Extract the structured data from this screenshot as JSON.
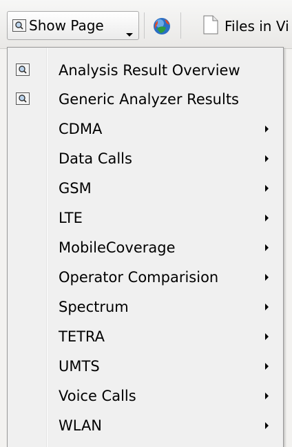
{
  "toolbar": {
    "show_page_label": "Show Page",
    "files_label": "Files in Vi"
  },
  "menu": {
    "items": [
      {
        "label": "Analysis Result Overview",
        "icon": "magnifier-icon",
        "has_submenu": false
      },
      {
        "label": "Generic Analyzer Results",
        "icon": "magnifier-icon",
        "has_submenu": false
      },
      {
        "label": "CDMA",
        "has_submenu": true
      },
      {
        "label": "Data Calls",
        "has_submenu": true
      },
      {
        "label": "GSM",
        "has_submenu": true
      },
      {
        "label": "LTE",
        "has_submenu": true
      },
      {
        "label": "MobileCoverage",
        "has_submenu": true
      },
      {
        "label": "Operator Comparision",
        "has_submenu": true
      },
      {
        "label": "Spectrum",
        "has_submenu": true
      },
      {
        "label": "TETRA",
        "has_submenu": true
      },
      {
        "label": "UMTS",
        "has_submenu": true
      },
      {
        "label": "Voice Calls",
        "has_submenu": true
      },
      {
        "label": "WLAN",
        "has_submenu": true
      }
    ]
  },
  "colors": {
    "menu_background": "#f0f0f0",
    "menu_border": "#979797",
    "toolbar_background": "#eeeeec"
  }
}
